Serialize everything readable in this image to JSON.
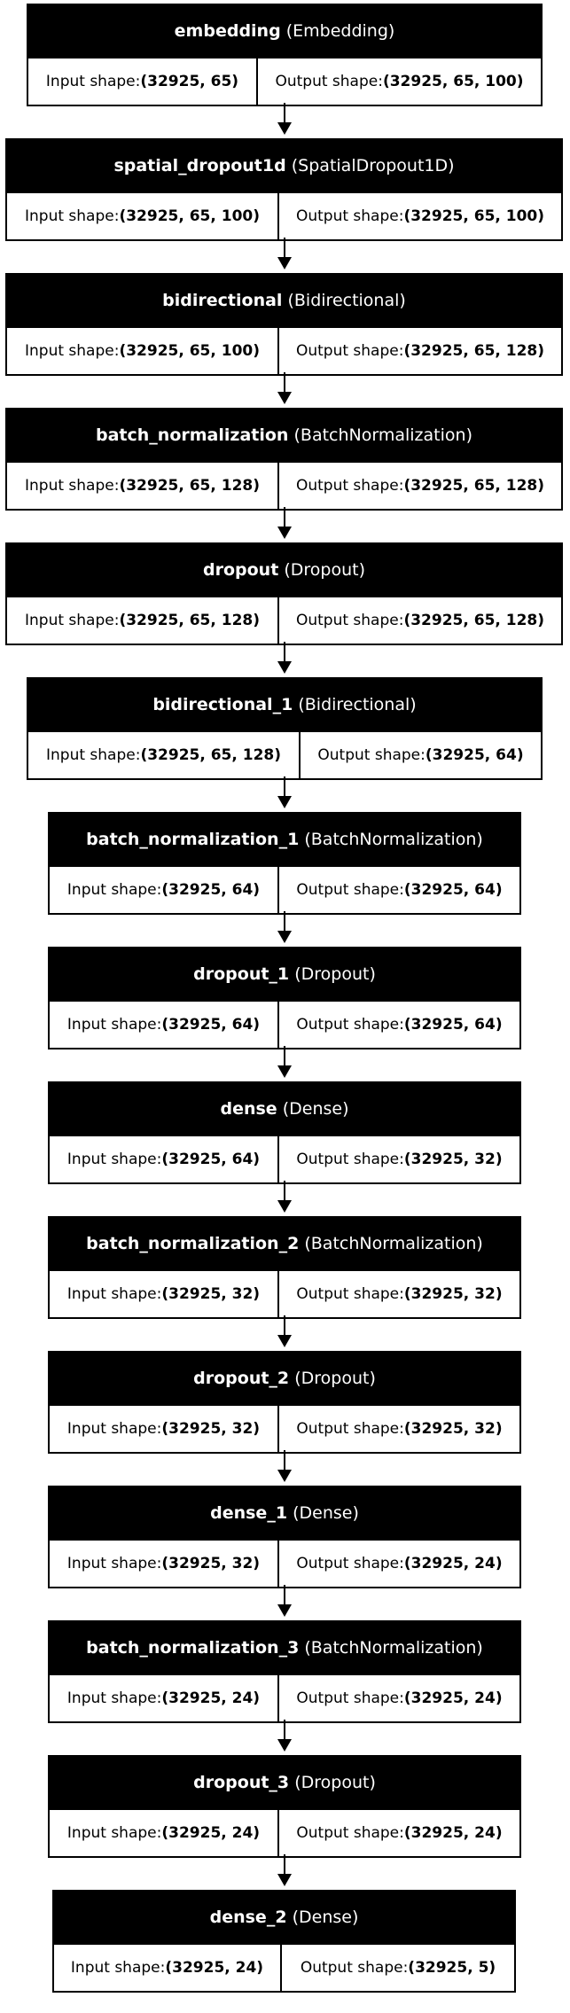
{
  "input_label": "Input shape: ",
  "output_label": "Output shape: ",
  "layers": [
    {
      "name": "embedding",
      "type": "(Embedding)",
      "input_shape": "(32925, 65)",
      "output_shape": "(32925, 65, 100)"
    },
    {
      "name": "spatial_dropout1d",
      "type": "(SpatialDropout1D)",
      "input_shape": "(32925, 65, 100)",
      "output_shape": "(32925, 65, 100)"
    },
    {
      "name": "bidirectional",
      "type": "(Bidirectional)",
      "input_shape": "(32925, 65, 100)",
      "output_shape": "(32925, 65, 128)"
    },
    {
      "name": "batch_normalization",
      "type": "(BatchNormalization)",
      "input_shape": "(32925, 65, 128)",
      "output_shape": "(32925, 65, 128)"
    },
    {
      "name": "dropout",
      "type": "(Dropout)",
      "input_shape": "(32925, 65, 128)",
      "output_shape": "(32925, 65, 128)"
    },
    {
      "name": "bidirectional_1",
      "type": "(Bidirectional)",
      "input_shape": "(32925, 65, 128)",
      "output_shape": "(32925, 64)"
    },
    {
      "name": "batch_normalization_1",
      "type": "(BatchNormalization)",
      "input_shape": "(32925, 64)",
      "output_shape": "(32925, 64)"
    },
    {
      "name": "dropout_1",
      "type": "(Dropout)",
      "input_shape": "(32925, 64)",
      "output_shape": "(32925, 64)"
    },
    {
      "name": "dense",
      "type": "(Dense)",
      "input_shape": "(32925, 64)",
      "output_shape": "(32925, 32)"
    },
    {
      "name": "batch_normalization_2",
      "type": "(BatchNormalization)",
      "input_shape": "(32925, 32)",
      "output_shape": "(32925, 32)"
    },
    {
      "name": "dropout_2",
      "type": "(Dropout)",
      "input_shape": "(32925, 32)",
      "output_shape": "(32925, 32)"
    },
    {
      "name": "dense_1",
      "type": "(Dense)",
      "input_shape": "(32925, 32)",
      "output_shape": "(32925, 24)"
    },
    {
      "name": "batch_normalization_3",
      "type": "(BatchNormalization)",
      "input_shape": "(32925, 24)",
      "output_shape": "(32925, 24)"
    },
    {
      "name": "dropout_3",
      "type": "(Dropout)",
      "input_shape": "(32925, 24)",
      "output_shape": "(32925, 24)"
    },
    {
      "name": "dense_2",
      "type": "(Dense)",
      "input_shape": "(32925, 24)",
      "output_shape": "(32925, 5)"
    }
  ]
}
